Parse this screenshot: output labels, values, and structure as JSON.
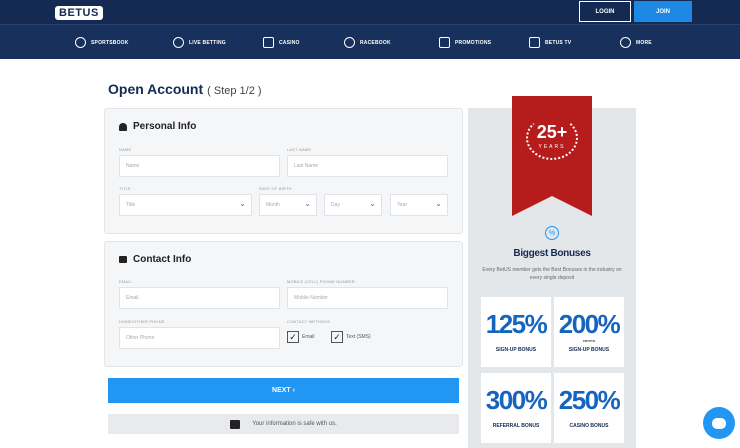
{
  "header": {
    "logo": "BETUS",
    "login": "LOGIN",
    "join": "JOIN"
  },
  "nav": [
    {
      "label": "SPORTSBOOK",
      "icon": "football-icon"
    },
    {
      "label": "LIVE BETTING",
      "icon": "stopwatch-icon"
    },
    {
      "label": "CASINO",
      "icon": "cards-icon"
    },
    {
      "label": "RACEBOOK",
      "icon": "horse-icon"
    },
    {
      "label": "PROMOTIONS",
      "icon": "gift-icon"
    },
    {
      "label": "BETUS TV",
      "icon": "tv-icon"
    },
    {
      "label": "MORE",
      "icon": "more-icon"
    }
  ],
  "page": {
    "title": "Open Account",
    "step": "( Step 1/2 )"
  },
  "personal": {
    "title": "Personal Info",
    "name_label": "NAME",
    "name_ph": "Name",
    "last_label": "LAST NAME",
    "last_ph": "Last Name",
    "title_label": "TITLE",
    "title_val": "Title",
    "dob_label": "DATE OF BIRTH",
    "month": "Month",
    "day": "Day",
    "year": "Year"
  },
  "contact": {
    "title": "Contact Info",
    "email_label": "EMAIL",
    "email_ph": "Email",
    "mobile_label": "MOBILE (CELL) PHONE NUMBER",
    "mobile_ph": "Mobile Number",
    "home_label": "HOME/OTHER PHONE",
    "home_ph": "Other Phone",
    "methods_label": "CONTACT METHODS",
    "method_email": "Email",
    "method_text": "Text (SMS)"
  },
  "actions": {
    "next": "NEXT ›",
    "safe": "Your information is safe with us."
  },
  "promo": {
    "ribbon_num": "25+",
    "ribbon_years": "YEARS",
    "title": "Biggest Bonuses",
    "subtitle": "Every BetUS member gets the Best Bonuses in the industry on every single deposit",
    "tiles": [
      {
        "pct": "125%",
        "small": "",
        "label": "SIGN-UP BONUS"
      },
      {
        "pct": "200%",
        "small": "CRYPTO",
        "label": "SIGN-UP BONUS"
      },
      {
        "pct": "300%",
        "small": "",
        "label": "REFERRAL BONUS"
      },
      {
        "pct": "250%",
        "small": "",
        "label": "CASINO BONUS"
      }
    ]
  },
  "colors": {
    "navy": "#142a52",
    "accent": "#2196f3",
    "ribbon": "#b71c1c"
  }
}
